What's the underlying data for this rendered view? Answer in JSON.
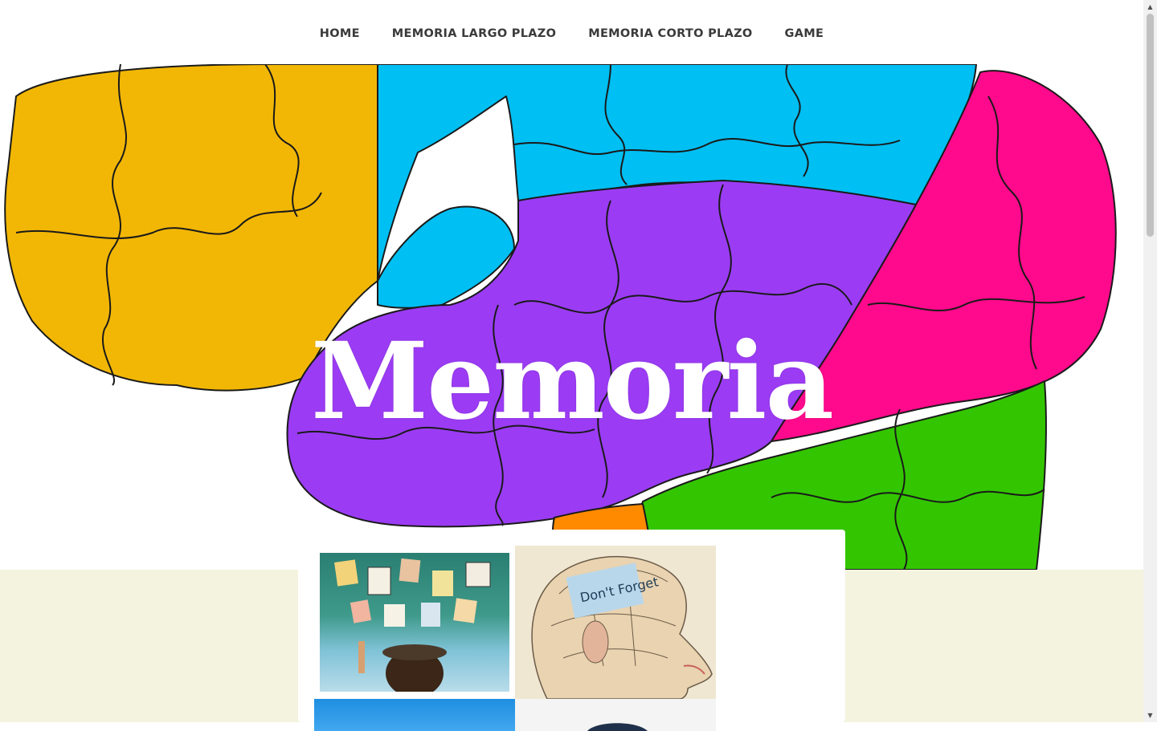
{
  "nav": {
    "items": [
      {
        "label": "HOME"
      },
      {
        "label": "MEMORIA LARGO PLAZO"
      },
      {
        "label": "MEMORIA CORTO PLAZO"
      },
      {
        "label": "GAME"
      }
    ]
  },
  "hero": {
    "title": "Memoria",
    "colors": {
      "yellow": "#f2b705",
      "blue": "#00bff3",
      "purple": "#9b3cf4",
      "pink": "#ff0a8c",
      "green": "#33c600",
      "orange": "#ff8a00"
    }
  },
  "gallery": {
    "thumb_2_note": "Don't Forget"
  },
  "colors": {
    "band_background": "#f3f3df",
    "nav_text": "#3a3a3a"
  }
}
